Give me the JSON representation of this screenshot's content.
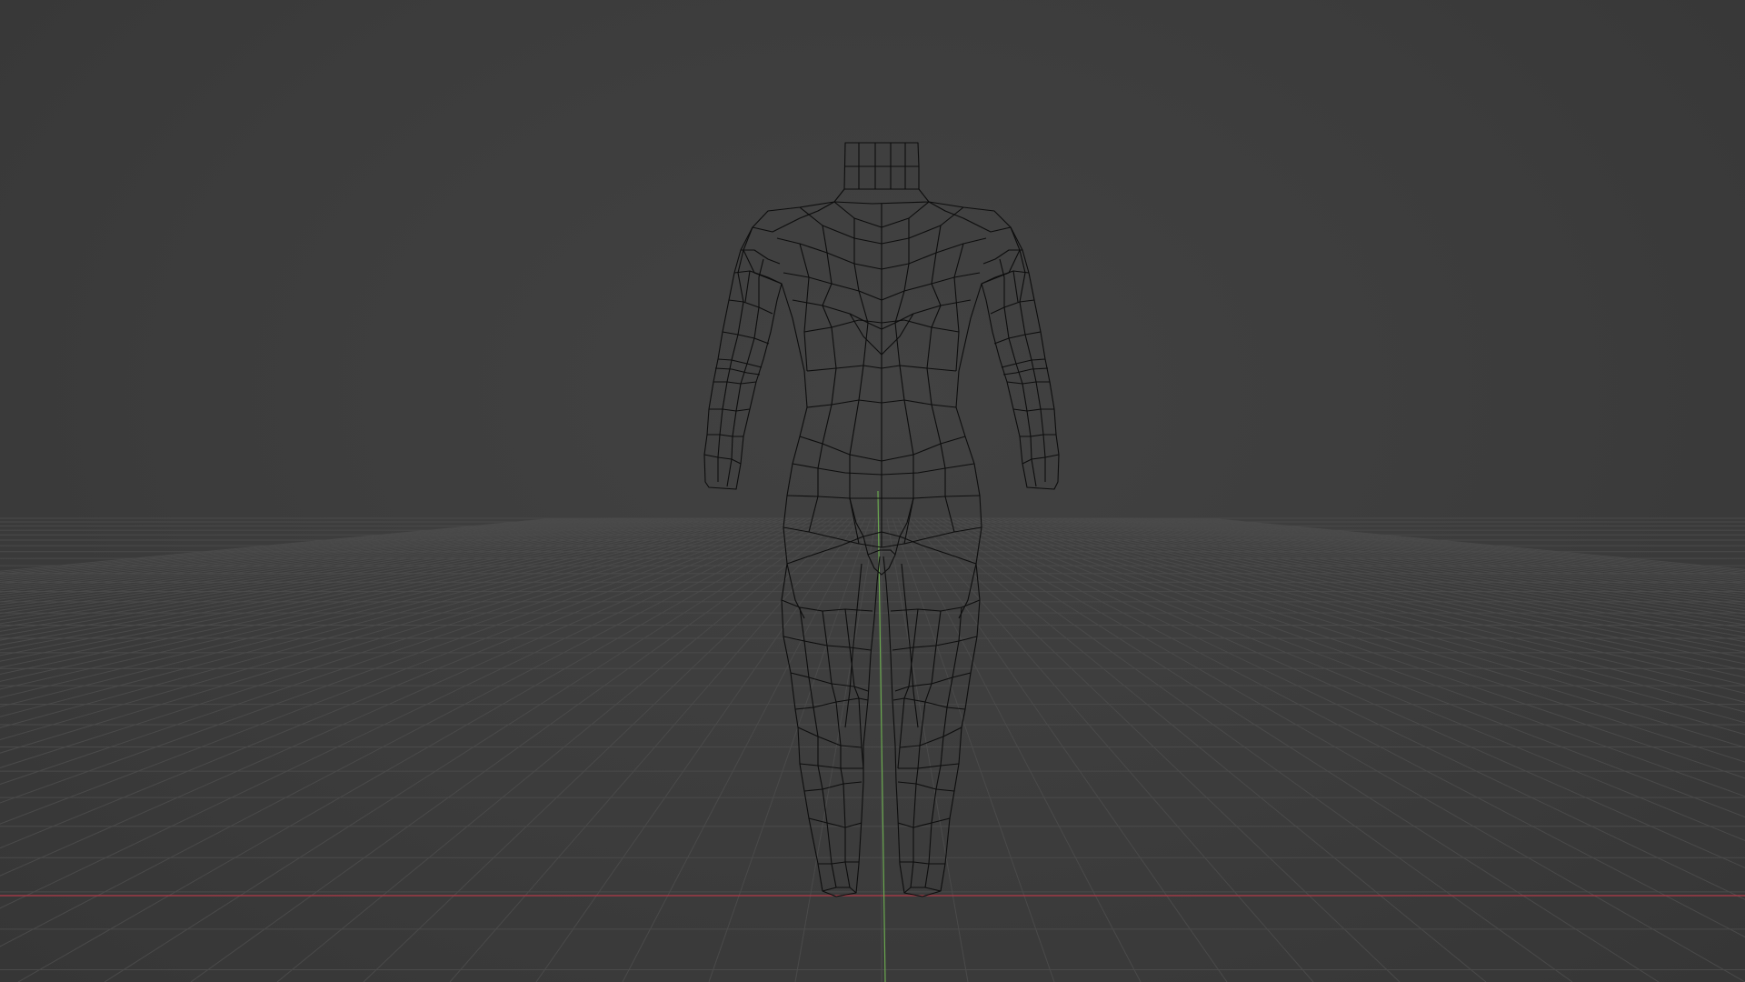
{
  "viewport": {
    "mode": "wireframe",
    "object": "human-body-mesh",
    "background_color": "#3d3d3d",
    "grid_color": "#4a4a4a",
    "wire_color": "#0c0c0c",
    "x_axis_color": "#b23a48",
    "y_axis_color": "#6aa84f"
  }
}
